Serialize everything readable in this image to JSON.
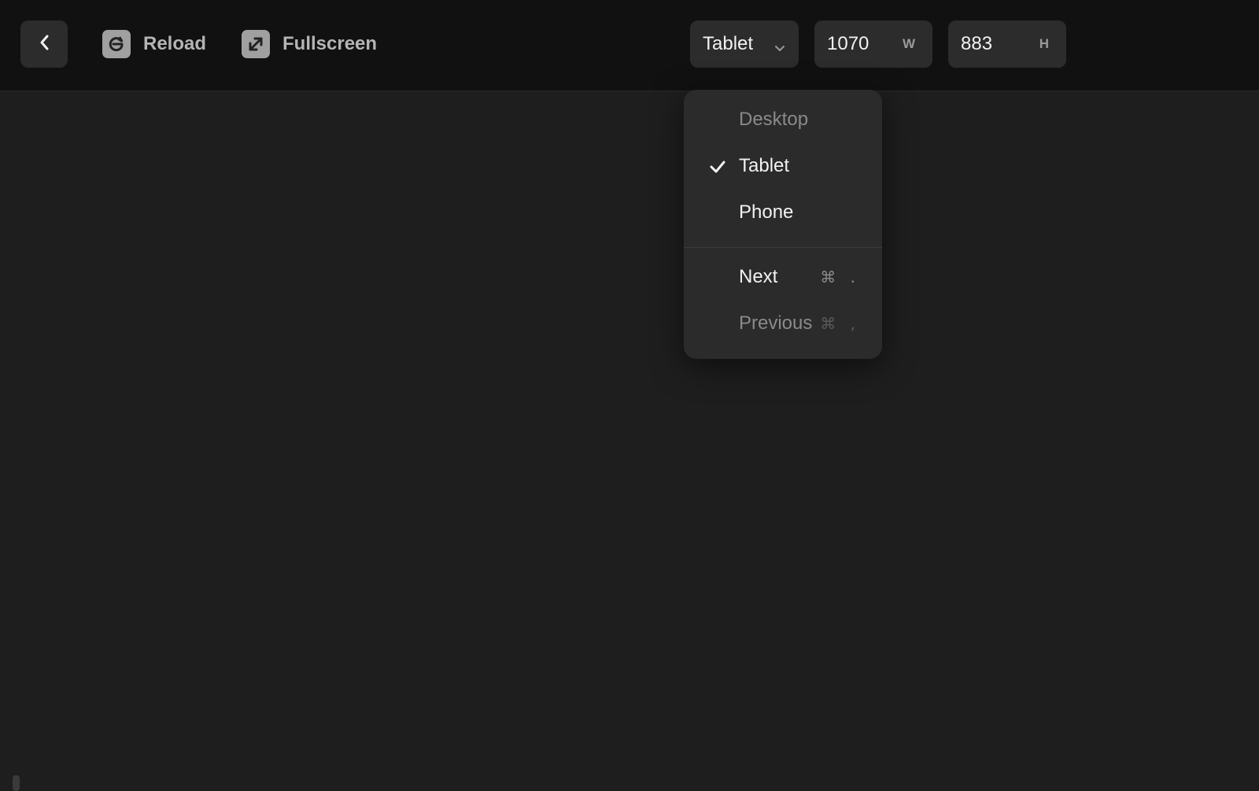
{
  "toolbar": {
    "reload_label": "Reload",
    "fullscreen_label": "Fullscreen"
  },
  "device_select": {
    "selected": "Tablet"
  },
  "dimensions": {
    "width_value": "1070",
    "width_unit": "W",
    "height_value": "883",
    "height_unit": "H"
  },
  "device_menu": {
    "items": [
      {
        "label": "Desktop",
        "checked": false,
        "enabled": false
      },
      {
        "label": "Tablet",
        "checked": true,
        "enabled": true
      },
      {
        "label": "Phone",
        "checked": false,
        "enabled": true
      }
    ],
    "next": {
      "label": "Next",
      "shortcut": "⌘ ."
    },
    "previous": {
      "label": "Previous",
      "shortcut": "⌘ ,"
    }
  },
  "colors": {
    "toolbar_bg": "#111111",
    "canvas_bg": "#1e1e1e",
    "menu_bg": "#2b2b2b",
    "control_bg": "#2c2c2c"
  }
}
